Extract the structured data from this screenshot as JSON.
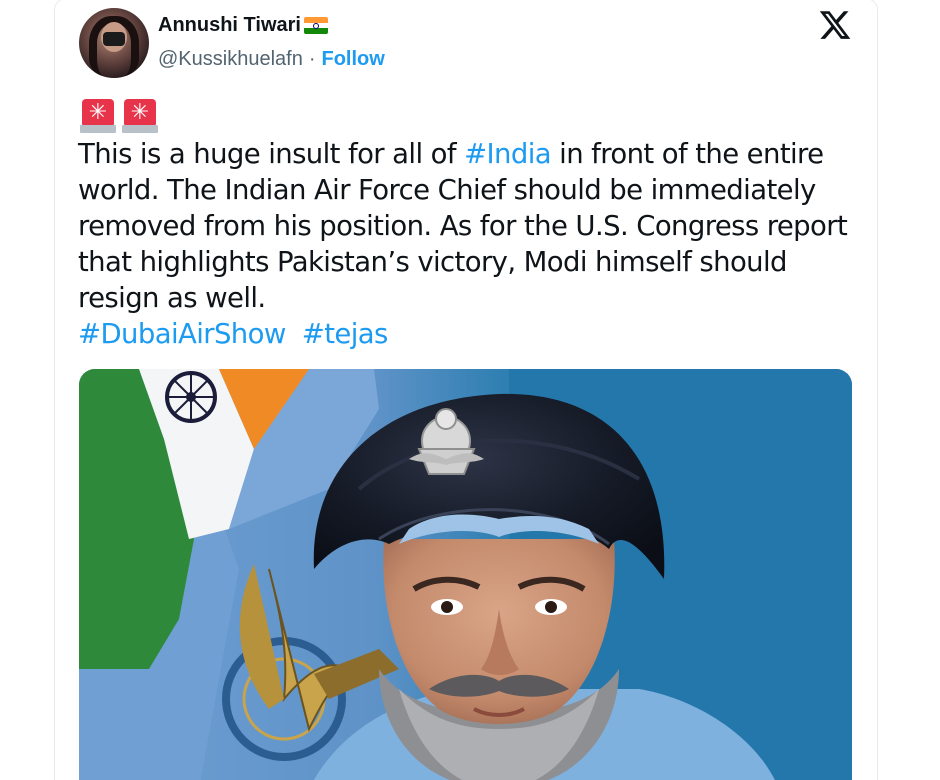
{
  "author": {
    "display_name": "Annushi Tiwari",
    "handle": "@Kussikhuelafn",
    "separator": "·",
    "follow_label": "Follow"
  },
  "icons": {
    "avatar": "profile-photo",
    "flag": "india-flag-emoji",
    "logo": "x-logo-icon",
    "sirens": [
      "police-siren-emoji",
      "police-siren-emoji"
    ]
  },
  "tweet": {
    "line1_pre": "This is a huge insult for all of ",
    "line1_tag": "#India",
    "line1_post": " in front of the entire",
    "line2": "world. The Indian Air Force Chief should be immediately",
    "line3": "removed from his position. As for the U.S. Congress report",
    "line4": "that highlights Pakistan’s victory, Modi himself should",
    "line5": "resign as well.",
    "hashtags": [
      "#DubaiAirShow",
      "#tejas"
    ]
  },
  "media": {
    "description_icon": "photo-officer-portrait"
  },
  "colors": {
    "link": "#1d9bf0",
    "text": "#0f1419",
    "secondary": "#536471",
    "siren_red": "#e8344a",
    "photo_bg": "#2b7cad"
  }
}
